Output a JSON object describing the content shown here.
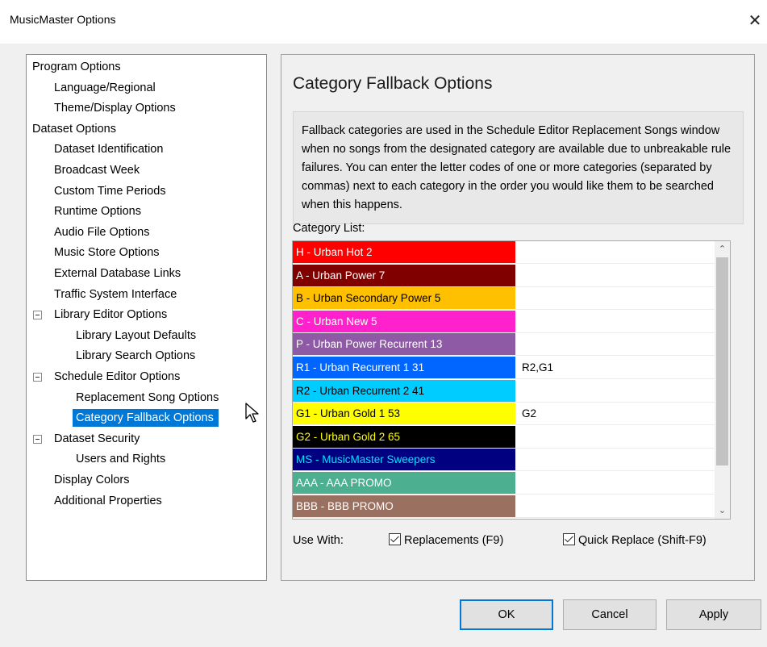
{
  "window": {
    "title": "MusicMaster Options",
    "close_glyph": "✕"
  },
  "tree": {
    "items": [
      {
        "label": "Program Options",
        "level": 0
      },
      {
        "label": "Language/Regional",
        "level": 1
      },
      {
        "label": "Theme/Display Options",
        "level": 1
      },
      {
        "label": "Dataset Options",
        "level": 0
      },
      {
        "label": "Dataset Identification",
        "level": 1
      },
      {
        "label": "Broadcast Week",
        "level": 1
      },
      {
        "label": "Custom Time Periods",
        "level": 1
      },
      {
        "label": "Runtime Options",
        "level": 1
      },
      {
        "label": "Audio File Options",
        "level": 1
      },
      {
        "label": "Music Store Options",
        "level": 1
      },
      {
        "label": "External Database Links",
        "level": 1
      },
      {
        "label": "Traffic System Interface",
        "level": 1
      },
      {
        "label": "Library Editor Options",
        "level": 1,
        "expanded": true
      },
      {
        "label": "Library Layout Defaults",
        "level": 2
      },
      {
        "label": "Library Search Options",
        "level": 2
      },
      {
        "label": "Schedule Editor Options",
        "level": 1,
        "expanded": true
      },
      {
        "label": "Replacement Song Options",
        "level": 2
      },
      {
        "label": "Category Fallback Options",
        "level": 2,
        "selected": true
      },
      {
        "label": "Dataset Security",
        "level": 1,
        "expanded": true
      },
      {
        "label": "Users and Rights",
        "level": 2
      },
      {
        "label": "Display Colors",
        "level": 1
      },
      {
        "label": "Additional Properties",
        "level": 1
      }
    ]
  },
  "panel": {
    "title": "Category Fallback Options",
    "description": "Fallback categories are used in the Schedule Editor Replacement Songs window when no songs from the designated category are available due to unbreakable rule failures. You can enter the letter codes of one or more categories (separated by commas) next to each category in the order you would like them to be searched when this happens.",
    "list_label": "Category List:",
    "categories": [
      {
        "name": "H - Urban Hot 2",
        "fallback": "",
        "bg": "#ff0000",
        "fg": "#ffffff"
      },
      {
        "name": "A - Urban Power 7",
        "fallback": "",
        "bg": "#800000",
        "fg": "#ffffff"
      },
      {
        "name": "B - Urban Secondary Power 5",
        "fallback": "",
        "bg": "#ffc000",
        "fg": "#000000"
      },
      {
        "name": "C - Urban New 5",
        "fallback": "",
        "bg": "#ff22cc",
        "fg": "#ffffff"
      },
      {
        "name": "P - Urban Power Recurrent 13",
        "fallback": "",
        "bg": "#8e5aa6",
        "fg": "#ffffff"
      },
      {
        "name": "R1 - Urban Recurrent 1 31",
        "fallback": "R2,G1",
        "bg": "#0066ff",
        "fg": "#ffffff"
      },
      {
        "name": "R2 - Urban Recurrent 2 41",
        "fallback": "",
        "bg": "#00ccff",
        "fg": "#000000"
      },
      {
        "name": "G1 - Urban Gold 1 53",
        "fallback": "G2",
        "bg": "#ffff00",
        "fg": "#000000"
      },
      {
        "name": "G2 - Urban Gold 2 65",
        "fallback": "",
        "bg": "#000000",
        "fg": "#ffff00"
      },
      {
        "name": "MS - MusicMaster Sweepers",
        "fallback": "",
        "bg": "#000080",
        "fg": "#00e5ff"
      },
      {
        "name": "AAA - AAA PROMO",
        "fallback": "",
        "bg": "#4caf8f",
        "fg": "#ffffff"
      },
      {
        "name": "BBB - BBB PROMO",
        "fallback": "",
        "bg": "#9a7060",
        "fg": "#ffffff"
      }
    ],
    "use_with_label": "Use With:",
    "checkboxes": [
      {
        "label": "Replacements (F9)",
        "checked": true
      },
      {
        "label": "Quick Replace (Shift-F9)",
        "checked": true
      }
    ]
  },
  "buttons": {
    "ok": "OK",
    "cancel": "Cancel",
    "apply": "Apply"
  }
}
